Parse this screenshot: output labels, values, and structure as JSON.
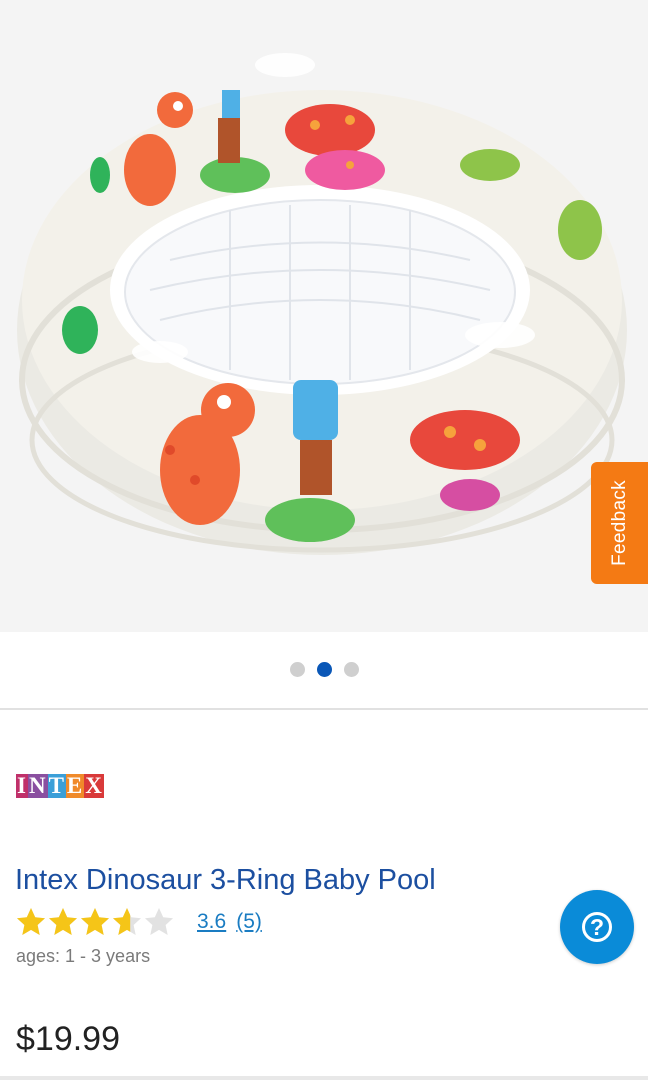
{
  "product_image": {
    "description_icon": "inflatable-dinosaur-pool-photo",
    "carousel_dots": 3,
    "active_dot_index": 1
  },
  "feedback": {
    "label": "Feedback",
    "color": "#f47a14"
  },
  "brand": {
    "letters": [
      "I",
      "N",
      "T",
      "E",
      "X"
    ],
    "colors": [
      "#c0306a",
      "#8a4fa0",
      "#3b9fd8",
      "#f08a2a",
      "#d93a3a"
    ]
  },
  "product": {
    "title": "Intex Dinosaur 3-Ring Baby Pool",
    "rating_value": "3.6",
    "rating_count": "(5)",
    "rating_stars": 3.6,
    "ages": "ages: 1 - 3 years",
    "price": "$19.99"
  },
  "help_button": {
    "icon": "question-icon",
    "label": "?"
  },
  "colors": {
    "accent": "#0a57b7",
    "title": "#1c4fa0",
    "link": "#1a7cc2",
    "star": "#f5c518"
  }
}
